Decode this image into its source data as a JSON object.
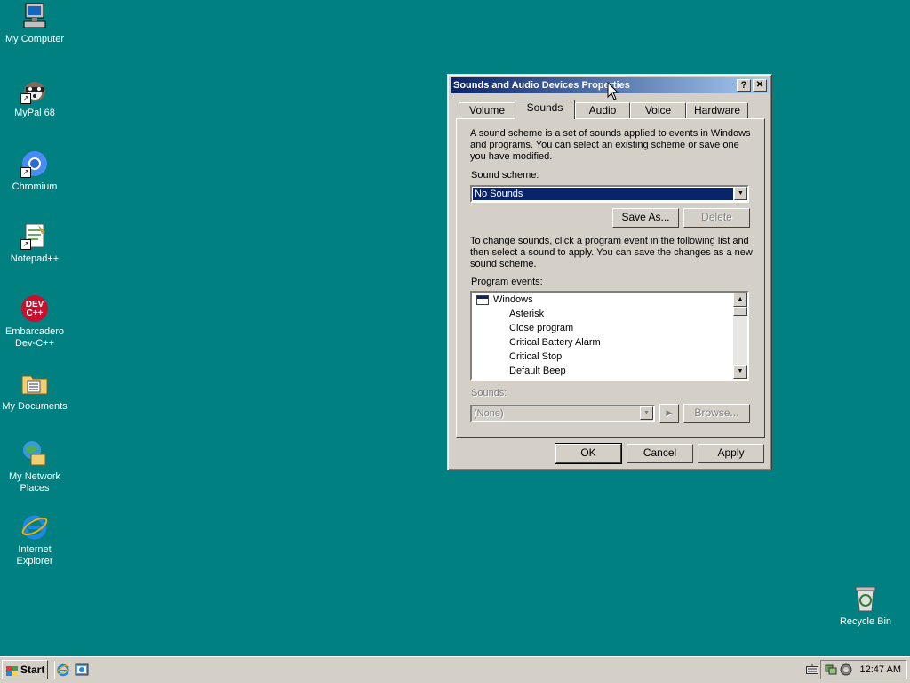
{
  "desktop": {
    "icons": [
      {
        "label": "My Computer"
      },
      {
        "label": "MyPal 68"
      },
      {
        "label": "Chromium"
      },
      {
        "label": "Notepad++"
      },
      {
        "label": "Embarcadero Dev-C++"
      },
      {
        "label": "My Documents"
      },
      {
        "label": "My Network Places"
      },
      {
        "label": "Internet Explorer"
      },
      {
        "label": "Recycle Bin"
      }
    ],
    "devcpp_glyph_text": "DEV\nC++"
  },
  "dialog": {
    "title": "Sounds and Audio Devices Properties",
    "help_label": "?",
    "close_label": "✕",
    "tabs": [
      "Volume",
      "Sounds",
      "Audio",
      "Voice",
      "Hardware"
    ],
    "active_tab": "Sounds",
    "scheme_description": "A sound scheme is a set of sounds applied to events in Windows and programs. You can select an existing scheme or save one you have modified.",
    "scheme_label": "Sound scheme:",
    "scheme_value": "No Sounds",
    "save_as_label": "Save As...",
    "delete_label": "Delete",
    "change_description": "To change sounds, click a program event in the following list and then select a sound to apply. You can save the changes as a new sound scheme.",
    "events_label": "Program events:",
    "events_group": "Windows",
    "events": [
      "Asterisk",
      "Close program",
      "Critical Battery Alarm",
      "Critical Stop",
      "Default Beep"
    ],
    "sounds_label": "Sounds:",
    "sounds_value": "(None)",
    "play_label": "▶",
    "browse_label": "Browse...",
    "ok_label": "OK",
    "cancel_label": "Cancel",
    "apply_label": "Apply"
  },
  "taskbar": {
    "start_label": "Start",
    "clock": "12:47 AM"
  },
  "colors": {
    "desktop": "#008080",
    "title_active": "#0a246a",
    "selection": "#0a246a",
    "face": "#d4d0c8"
  }
}
